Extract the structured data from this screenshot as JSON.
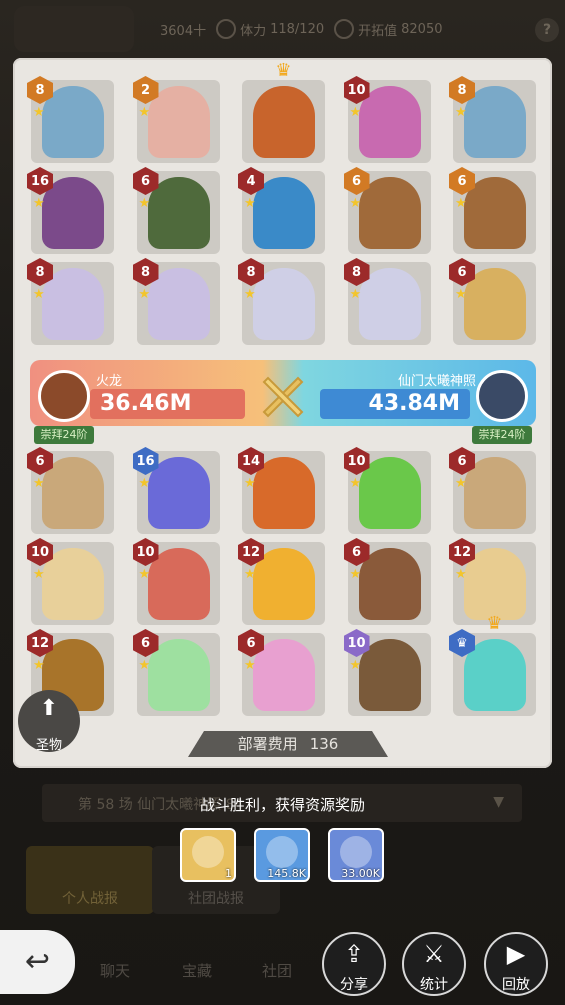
{
  "topbar": {
    "res1": "3604十",
    "res2_label": "体力",
    "res2_value": "118/120",
    "res3_label": "开拓值",
    "res3_value": "82050",
    "help": "?"
  },
  "rows_top": [
    [
      {
        "lvl": "8",
        "tone": "orange",
        "star": true,
        "art": "#7aa9c8"
      },
      {
        "lvl": "2",
        "tone": "orange",
        "star": true,
        "art": "#e5b0a3"
      },
      {
        "lvl": "",
        "tone": "",
        "star": false,
        "art": "#c8642c",
        "crown": true
      },
      {
        "lvl": "10",
        "tone": "red",
        "star": true,
        "art": "#c86ab0"
      },
      {
        "lvl": "8",
        "tone": "orange",
        "star": true,
        "art": "#7aa9c8"
      }
    ],
    [
      {
        "lvl": "16",
        "tone": "red",
        "star": true,
        "art": "#7b4a8a"
      },
      {
        "lvl": "6",
        "tone": "red",
        "star": true,
        "art": "#4f6a3c"
      },
      {
        "lvl": "4",
        "tone": "red",
        "star": true,
        "art": "#3a8ac8"
      },
      {
        "lvl": "6",
        "tone": "orange",
        "star": true,
        "art": "#a06a3a"
      },
      {
        "lvl": "6",
        "tone": "orange",
        "star": true,
        "art": "#a06a3a"
      }
    ],
    [
      {
        "lvl": "8",
        "tone": "red",
        "star": true,
        "art": "#c9bfe2"
      },
      {
        "lvl": "8",
        "tone": "red",
        "star": true,
        "art": "#c9bfe2"
      },
      {
        "lvl": "8",
        "tone": "red",
        "star": true,
        "art": "#cfcfe6"
      },
      {
        "lvl": "8",
        "tone": "red",
        "star": true,
        "art": "#cfcfe6"
      },
      {
        "lvl": "6",
        "tone": "red",
        "star": true,
        "art": "#d8b060"
      }
    ]
  ],
  "versus": {
    "left_name": "火龙",
    "left_value": "36.46M",
    "left_tag": "崇拜24阶",
    "right_name": "仙门太曦神照",
    "right_value": "43.84M",
    "right_tag": "崇拜24阶"
  },
  "rows_bottom": [
    [
      {
        "lvl": "6",
        "tone": "red",
        "star": true,
        "art": "#c9a87a"
      },
      {
        "lvl": "16",
        "tone": "blue",
        "star": true,
        "art": "#6a6ad8"
      },
      {
        "lvl": "14",
        "tone": "red",
        "star": true,
        "art": "#d86a2a"
      },
      {
        "lvl": "10",
        "tone": "red",
        "star": true,
        "art": "#6ac84a"
      },
      {
        "lvl": "6",
        "tone": "red",
        "star": true,
        "art": "#c9a87a"
      }
    ],
    [
      {
        "lvl": "10",
        "tone": "red",
        "star": true,
        "art": "#e8d09a"
      },
      {
        "lvl": "10",
        "tone": "red",
        "star": true,
        "art": "#d86a5a"
      },
      {
        "lvl": "12",
        "tone": "red",
        "star": true,
        "art": "#f0b030"
      },
      {
        "lvl": "6",
        "tone": "red",
        "star": true,
        "art": "#8a5a3a"
      },
      {
        "lvl": "12",
        "tone": "red",
        "star": true,
        "art": "#e8cc90"
      }
    ],
    [
      {
        "lvl": "12",
        "tone": "red",
        "star": true,
        "art": "#a8742a"
      },
      {
        "lvl": "6",
        "tone": "red",
        "star": true,
        "art": "#9ee0a0"
      },
      {
        "lvl": "6",
        "tone": "red",
        "star": true,
        "art": "#e8a0d0"
      },
      {
        "lvl": "10",
        "tone": "purple",
        "star": true,
        "art": "#7a5a3a"
      },
      {
        "lvl": "",
        "tone": "blue",
        "star": false,
        "art": "#5ad0c8",
        "crown": true
      }
    ]
  ],
  "cost": {
    "label": "部署费用",
    "value": "136"
  },
  "relic": {
    "label": "圣物"
  },
  "background": {
    "battle_row": "第 58 场  仙门太曦神照 84",
    "tab_personal": "个人战报",
    "tab_guild": "社团战报",
    "nav": [
      "聊天",
      "宝藏",
      "社团"
    ]
  },
  "victory": "战斗胜利，获得资源奖励",
  "rewards": [
    {
      "count": "1",
      "color": "#e8c060"
    },
    {
      "count": "145.8K",
      "color": "#5a9ae0"
    },
    {
      "count": "33.00K",
      "color": "#6a8ad8"
    }
  ],
  "actions": {
    "share": "分享",
    "stats": "统计",
    "replay": "回放"
  },
  "colors": {
    "left_accent": "#e2705e",
    "right_accent": "#3e8ad4",
    "star": "#f3c52b"
  }
}
